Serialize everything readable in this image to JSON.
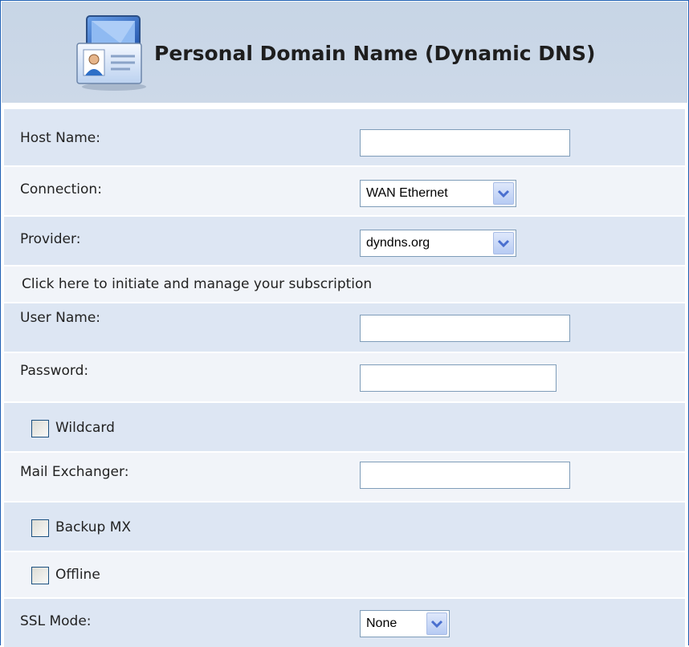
{
  "header": {
    "title": "Personal Domain Name (Dynamic DNS)",
    "icon": "address-card-icon"
  },
  "form": {
    "host_name": {
      "label": "Host Name:",
      "value": ""
    },
    "connection": {
      "label": "Connection:",
      "selected": "WAN Ethernet"
    },
    "provider": {
      "label": "Provider:",
      "selected": "dyndns.org"
    },
    "subscription_link": "Click here to initiate and manage your subscription",
    "user_name": {
      "label": "User Name:",
      "value": ""
    },
    "password": {
      "label": "Password:",
      "value": ""
    },
    "wildcard": {
      "label": "Wildcard",
      "checked": false
    },
    "mail_exchanger": {
      "label": "Mail Exchanger:",
      "value": ""
    },
    "backup_mx": {
      "label": "Backup MX",
      "checked": false
    },
    "offline": {
      "label": "Offline",
      "checked": false
    },
    "ssl_mode": {
      "label": "SSL Mode:",
      "selected": "None"
    }
  },
  "colors": {
    "border": "#1e5fb4",
    "header_bg": "#c9d7e8",
    "row_even": "#dde6f3",
    "row_odd": "#f1f4f9",
    "dropdown_arrow": "#4a6fcf"
  }
}
